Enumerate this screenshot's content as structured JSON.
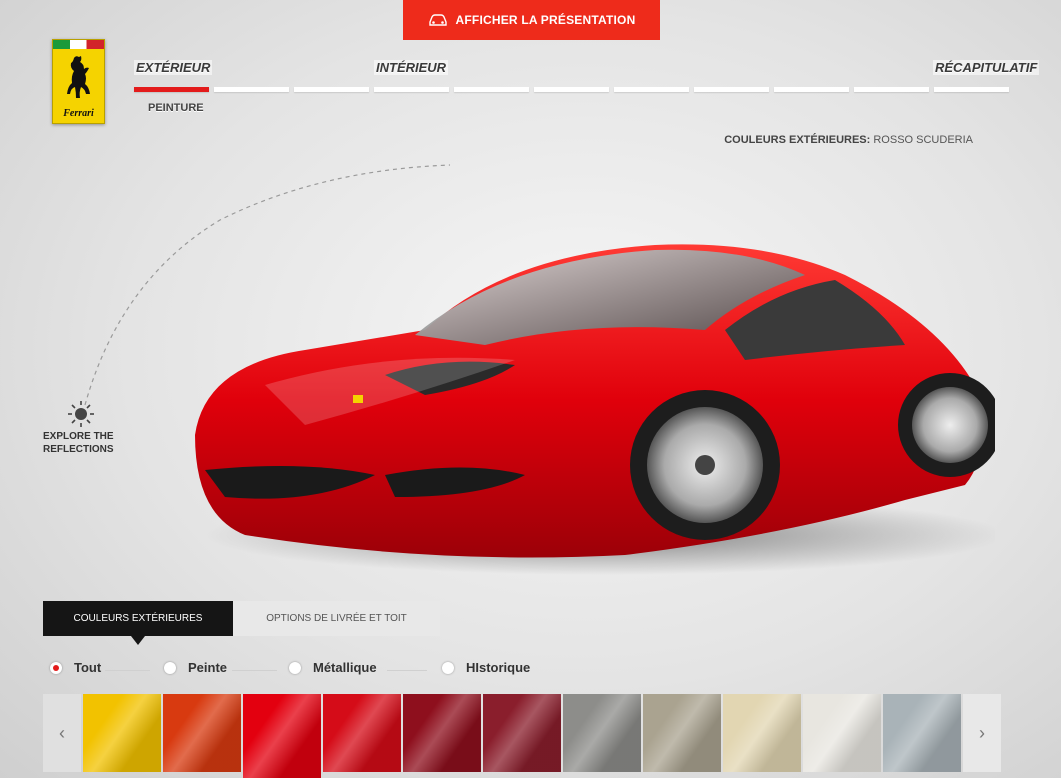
{
  "header": {
    "presentation_button": "AFFICHER LA PRÉSENTATION"
  },
  "logo": {
    "brand": "Ferrari"
  },
  "steps": {
    "labels": [
      "EXTÉRIEUR",
      "INTÉRIEUR",
      "RÉCAPITULATIF"
    ],
    "sub_label": "PEINTURE",
    "total_segments": 11,
    "active_segment": 1
  },
  "color_info": {
    "label": "COULEURS EXTÉRIEURES:",
    "value": "ROSSO SCUDERIA"
  },
  "reflections": {
    "line1": "EXPLORE THE",
    "line2": "REFLECTIONS"
  },
  "tabs": {
    "exterior_colors": "COULEURS EXTÉRIEURES",
    "livery_roof": "OPTIONS DE LIVRÉE ET TOIT"
  },
  "filters": {
    "items": [
      "Tout",
      "Peinte",
      "Métallique",
      "HIstorique"
    ],
    "selected": "Tout"
  },
  "swatches": {
    "colors": [
      "#f2c200",
      "#d83a10",
      "#e3000f",
      "#d50c18",
      "#8e0f1d",
      "#8a1e2c",
      "#8d8d8a",
      "#aaa390",
      "#e2d6b2",
      "#e8e6e0",
      "#a9b3b8"
    ],
    "selected_index": 2
  },
  "icons": {
    "presentation": "car-icon",
    "reflections": "sun-icon",
    "prev": "chevron-left-icon",
    "next": "chevron-right-icon"
  },
  "accent_color": "#ee2b1b"
}
